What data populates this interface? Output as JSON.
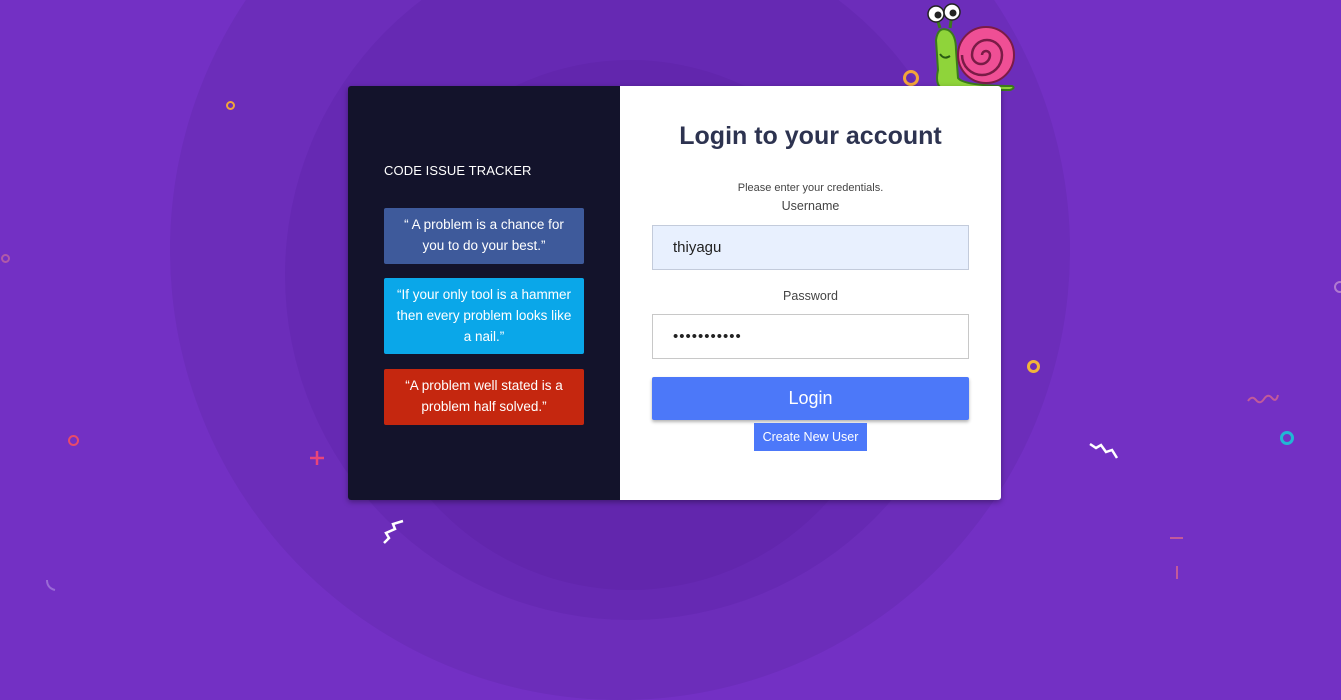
{
  "brand": {
    "name": "CODE ISSUE TRACKER"
  },
  "quotes": [
    {
      "text": "“ A problem is a chance for you to do your best.”",
      "color": "#3e5a9b"
    },
    {
      "text": "“If your only tool is a hammer then every problem looks like a nail.”",
      "color": "#0aa7e9"
    },
    {
      "text": "“A problem well stated is a problem half solved.”",
      "color": "#c5270f"
    }
  ],
  "login": {
    "title": "Login to your account",
    "subtitle": "Please enter your credentials.",
    "username_label": "Username",
    "username_value": "thiyagu",
    "password_label": "Password",
    "password_value": "•••••••••••",
    "login_button": "Login",
    "create_button": "Create New User"
  },
  "colors": {
    "background": "#7330c4",
    "left_panel": "#13132b",
    "accent": "#4c78f9",
    "title": "#2d3350"
  },
  "icons": {
    "mascot": "snail-icon"
  }
}
